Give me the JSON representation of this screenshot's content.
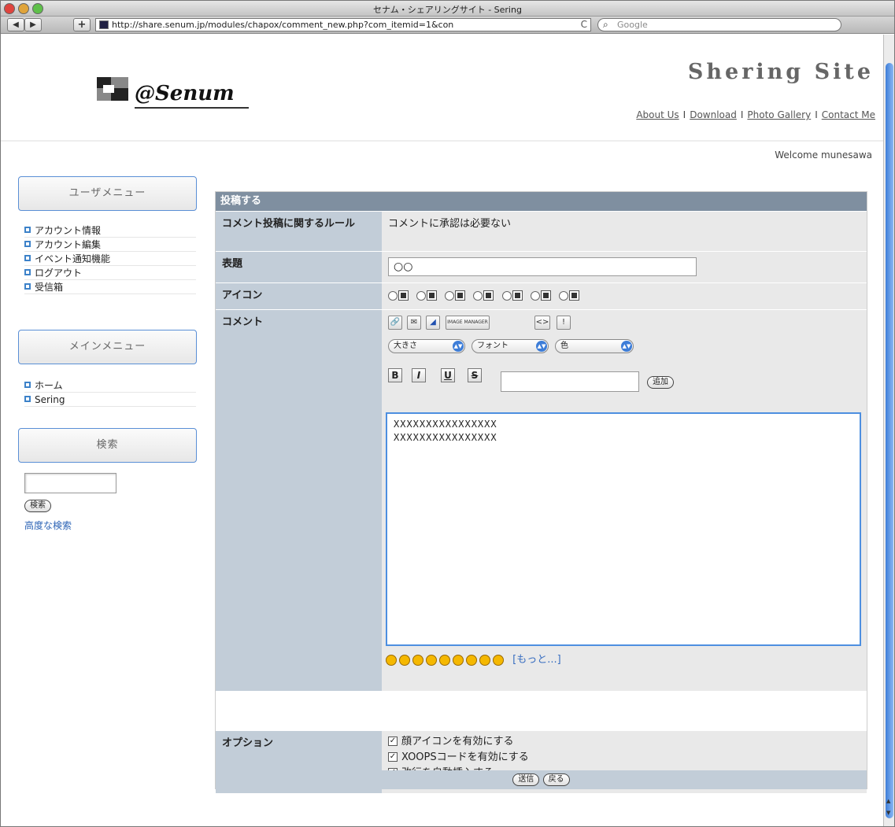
{
  "window": {
    "title": "セナム・シェアリングサイト - Sering"
  },
  "browser": {
    "back": "◀",
    "forward": "▶",
    "add": "+",
    "url": "http://share.senum.jp/modules/chapox/comment_new.php?com_itemid=1&con",
    "reload": "C",
    "search_placeholder": "Google"
  },
  "header": {
    "logo_text": "@Senum",
    "site_title": "Shering Site",
    "nav": [
      "About Us",
      "Download",
      "Photo Gallery",
      "Contact Me"
    ],
    "nav_sep": "I",
    "welcome": "Welcome munesawa"
  },
  "sidebar": {
    "user_menu_title": "ユーザメニュー",
    "user_menu_items": [
      "アカウント情報",
      "アカウント編集",
      "イベント通知機能",
      "ログアウト",
      "受信箱"
    ],
    "main_menu_title": "メインメニュー",
    "main_menu_items": [
      "ホーム",
      "Sering"
    ],
    "search_title": "検索",
    "search_button": "検索",
    "advanced_search": "高度な検索"
  },
  "form": {
    "header": "投稿する",
    "rule_label": "コメント投稿に関するルール",
    "rule_value": "コメントに承認は必要ない",
    "title_label": "表題",
    "title_value": "○○",
    "icon_label": "アイコン",
    "comment_label": "コメント",
    "toolbar": {
      "size_select": "大きさ",
      "font_select": "フォント",
      "color_select": "色",
      "bold": "B",
      "italic": "I",
      "underline": "U",
      "strike": "S",
      "add_button": "追加",
      "image_manager": "IMAGE MANAGER"
    },
    "comment_text": "XXXXXXXXXXXXXXXX\nXXXXXXXXXXXXXXXX",
    "more_smilies": "[もっと...]",
    "options_label": "オプション",
    "options": [
      "顔アイコンを有効にする",
      "XOOPSコードを有効にする",
      "改行を自動挿入する"
    ],
    "submit_button": "送信",
    "back_button": "戻る"
  },
  "colors": {
    "accent": "#3d82c9",
    "form_header": "#7f8fa0",
    "label_bg": "#c2cdd8",
    "value_bg": "#e9e9e9"
  }
}
